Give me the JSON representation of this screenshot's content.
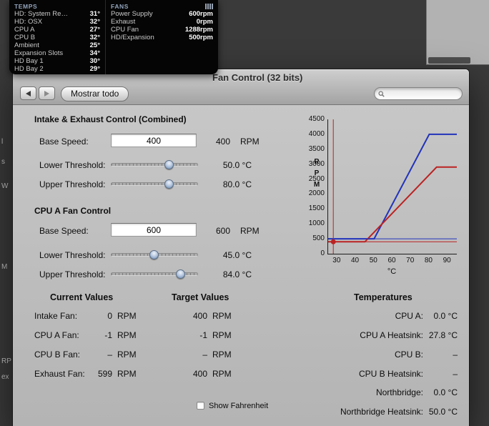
{
  "monitor": {
    "temps": {
      "title": "TEMPS",
      "rows": [
        {
          "label": "HD: System Re…",
          "value": "31°"
        },
        {
          "label": "HD: OSX",
          "value": "32°"
        },
        {
          "label": "CPU A",
          "value": "27°"
        },
        {
          "label": "CPU B",
          "value": "32°"
        },
        {
          "label": "Ambient",
          "value": "25°"
        },
        {
          "label": "Expansion Slots",
          "value": "34°"
        },
        {
          "label": "HD Bay 1",
          "value": "30°"
        },
        {
          "label": "HD Bay 2",
          "value": "29°"
        }
      ]
    },
    "fans": {
      "title": "FANS",
      "rows": [
        {
          "label": "Power Supply",
          "value": "600rpm"
        },
        {
          "label": "Exhaust",
          "value": "0rpm"
        },
        {
          "label": "CPU Fan",
          "value": "1288rpm"
        },
        {
          "label": "HD/Expansion",
          "value": "500rpm"
        }
      ]
    }
  },
  "window": {
    "title": "Fan Control (32 bits)",
    "toolbar": {
      "show_all_label": "Mostrar todo"
    },
    "sections": [
      {
        "title": "Intake & Exhaust Control (Combined)",
        "base": {
          "label": "Base Speed:",
          "field_value": "400",
          "value": "400",
          "unit": "RPM"
        },
        "lower": {
          "label": "Lower Threshold:",
          "value": "50.0 °C",
          "thumb_pct": 67
        },
        "upper": {
          "label": "Upper Threshold:",
          "value": "80.0 °C",
          "thumb_pct": 67
        }
      },
      {
        "title": "CPU A Fan Control",
        "base": {
          "label": "Base Speed:",
          "field_value": "600",
          "value": "600",
          "unit": "RPM"
        },
        "lower": {
          "label": "Lower Threshold:",
          "value": "45.0 °C",
          "thumb_pct": 50
        },
        "upper": {
          "label": "Upper Threshold:",
          "value": "84.0 °C",
          "thumb_pct": 80
        }
      }
    ],
    "readouts": {
      "current_title": "Current Values",
      "target_title": "Target Values",
      "temps_title": "Temperatures",
      "fan_rows": [
        {
          "label": "Intake Fan:",
          "current": "0",
          "target": "400",
          "unit": "RPM"
        },
        {
          "label": "CPU A Fan:",
          "current": "-1",
          "target": "-1",
          "unit": "RPM"
        },
        {
          "label": "CPU B Fan:",
          "current": "–",
          "target": "–",
          "unit": "RPM"
        },
        {
          "label": "Exhaust Fan:",
          "current": "599",
          "target": "400",
          "unit": "RPM"
        }
      ],
      "temp_rows": [
        {
          "label": "CPU A:",
          "value": "0.0 °C"
        },
        {
          "label": "CPU A Heatsink:",
          "value": "27.8 °C"
        },
        {
          "label": "CPU B:",
          "value": "–"
        },
        {
          "label": "CPU B Heatsink:",
          "value": "–"
        },
        {
          "label": "Northbridge:",
          "value": "0.0 °C"
        },
        {
          "label": "Northbridge Heatsink:",
          "value": "50.0 °C"
        }
      ],
      "fahrenheit_label": "Show Fahrenheit"
    }
  },
  "chart_data": {
    "type": "line",
    "xlabel": "°C",
    "ylabel": "RPM",
    "xlim": [
      25,
      95
    ],
    "ylim": [
      0,
      4500
    ],
    "xticks": [
      30,
      40,
      50,
      60,
      70,
      80,
      90
    ],
    "yticks": [
      0,
      500,
      1000,
      1500,
      2000,
      2500,
      3000,
      3500,
      4000,
      4500
    ],
    "series": [
      {
        "name": "intake exhaust curve",
        "color": "#2233bb",
        "width": 2,
        "points": [
          [
            25,
            500
          ],
          [
            50,
            500
          ],
          [
            80,
            4000
          ],
          [
            95,
            4000
          ]
        ]
      },
      {
        "name": "cpu a curve",
        "color": "#bb2222",
        "width": 2,
        "points": [
          [
            25,
            400
          ],
          [
            45,
            400
          ],
          [
            84,
            2900
          ],
          [
            95,
            2900
          ]
        ]
      },
      {
        "name": "intake current level",
        "color": "#2233bb",
        "width": 1,
        "points": [
          [
            25,
            500
          ],
          [
            95,
            500
          ]
        ]
      },
      {
        "name": "cpu a current level",
        "color": "#bb2222",
        "width": 1,
        "points": [
          [
            25,
            400
          ],
          [
            95,
            400
          ]
        ]
      },
      {
        "name": "current temperature marker",
        "color": "#bb2222",
        "width": 1,
        "points": [
          [
            27.8,
            0
          ],
          [
            27.8,
            4500
          ]
        ]
      }
    ],
    "marker": {
      "x": 27.8,
      "y": 400,
      "color": "#bb2222",
      "r": 3.5
    }
  },
  "background": {
    "fragments": [
      {
        "text": "l",
        "top": 193
      },
      {
        "text": "s",
        "top": 221
      },
      {
        "text": "W",
        "top": 255
      },
      {
        "text": "M",
        "top": 368
      },
      {
        "text": "RP",
        "top": 500
      },
      {
        "text": "ex",
        "top": 522
      }
    ]
  }
}
